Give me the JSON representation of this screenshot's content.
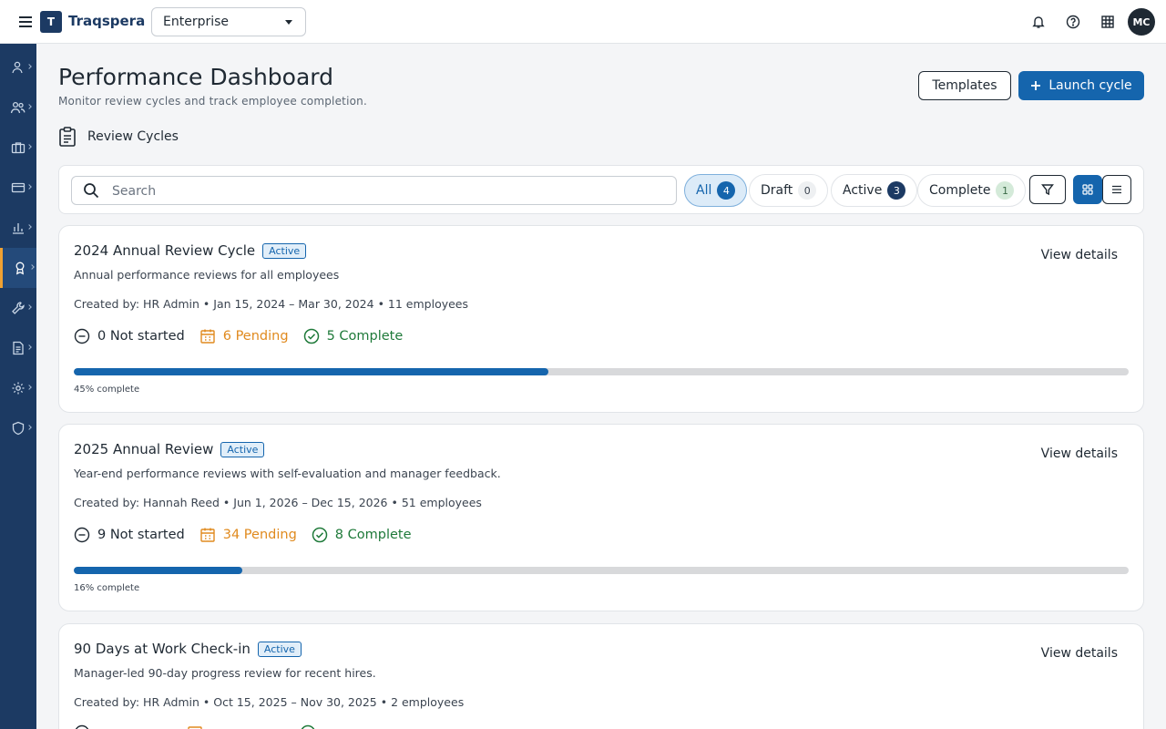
{
  "app": {
    "logo_letter": "T",
    "name": "Traqspera"
  },
  "org_select": {
    "value": "Enterprise"
  },
  "user": {
    "initials": "MC"
  },
  "header": {
    "title": "Performance Dashboard",
    "subtitle": "Monitor review cycles and track employee completion.",
    "templates_label": "Templates",
    "launch_label": "Launch cycle",
    "section_label": "Review Cycles"
  },
  "search": {
    "placeholder": "Search",
    "value": ""
  },
  "filters": [
    {
      "label": "All",
      "count": "4"
    },
    {
      "label": "Draft",
      "count": "0"
    },
    {
      "label": "Active",
      "count": "3"
    },
    {
      "label": "Complete",
      "count": "1"
    }
  ],
  "sidebar": {
    "items": [
      {
        "icon": "person-icon"
      },
      {
        "icon": "people-icon"
      },
      {
        "icon": "briefcase-icon"
      },
      {
        "icon": "card-icon"
      },
      {
        "icon": "bar-chart-icon"
      },
      {
        "icon": "award-icon",
        "active": true
      },
      {
        "icon": "wrench-icon"
      },
      {
        "icon": "document-icon"
      },
      {
        "icon": "gear-icon"
      },
      {
        "icon": "shield-icon"
      }
    ]
  },
  "cycles": [
    {
      "title": "2024 Annual Review Cycle",
      "status": "Active",
      "description": "Annual performance reviews for all employees",
      "meta": "Created by: HR Admin • Jan 15, 2024 – Mar 30, 2024 • 11 employees",
      "not_started": "0 Not started",
      "pending": "6 Pending",
      "complete": "5 Complete",
      "progress": 45,
      "progress_label": "45% complete",
      "view_label": "View details"
    },
    {
      "title": "2025 Annual Review",
      "status": "Active",
      "description": "Year-end performance reviews with self-evaluation and manager feedback.",
      "meta": "Created by: Hannah Reed • Jun 1, 2026 – Dec 15, 2026 • 51 employees",
      "not_started": "9 Not started",
      "pending": "34 Pending",
      "complete": "8 Complete",
      "progress": 16,
      "progress_label": "16% complete",
      "view_label": "View details"
    },
    {
      "title": "90 Days at Work Check-in",
      "status": "Active",
      "description": "Manager-led 90-day progress review for recent hires.",
      "meta": "Created by: HR Admin • Oct 15, 2025 – Nov 30, 2025 • 2 employees",
      "not_started": "",
      "pending": "",
      "complete": "",
      "progress": 0,
      "progress_label": "",
      "view_label": "View details"
    }
  ]
}
